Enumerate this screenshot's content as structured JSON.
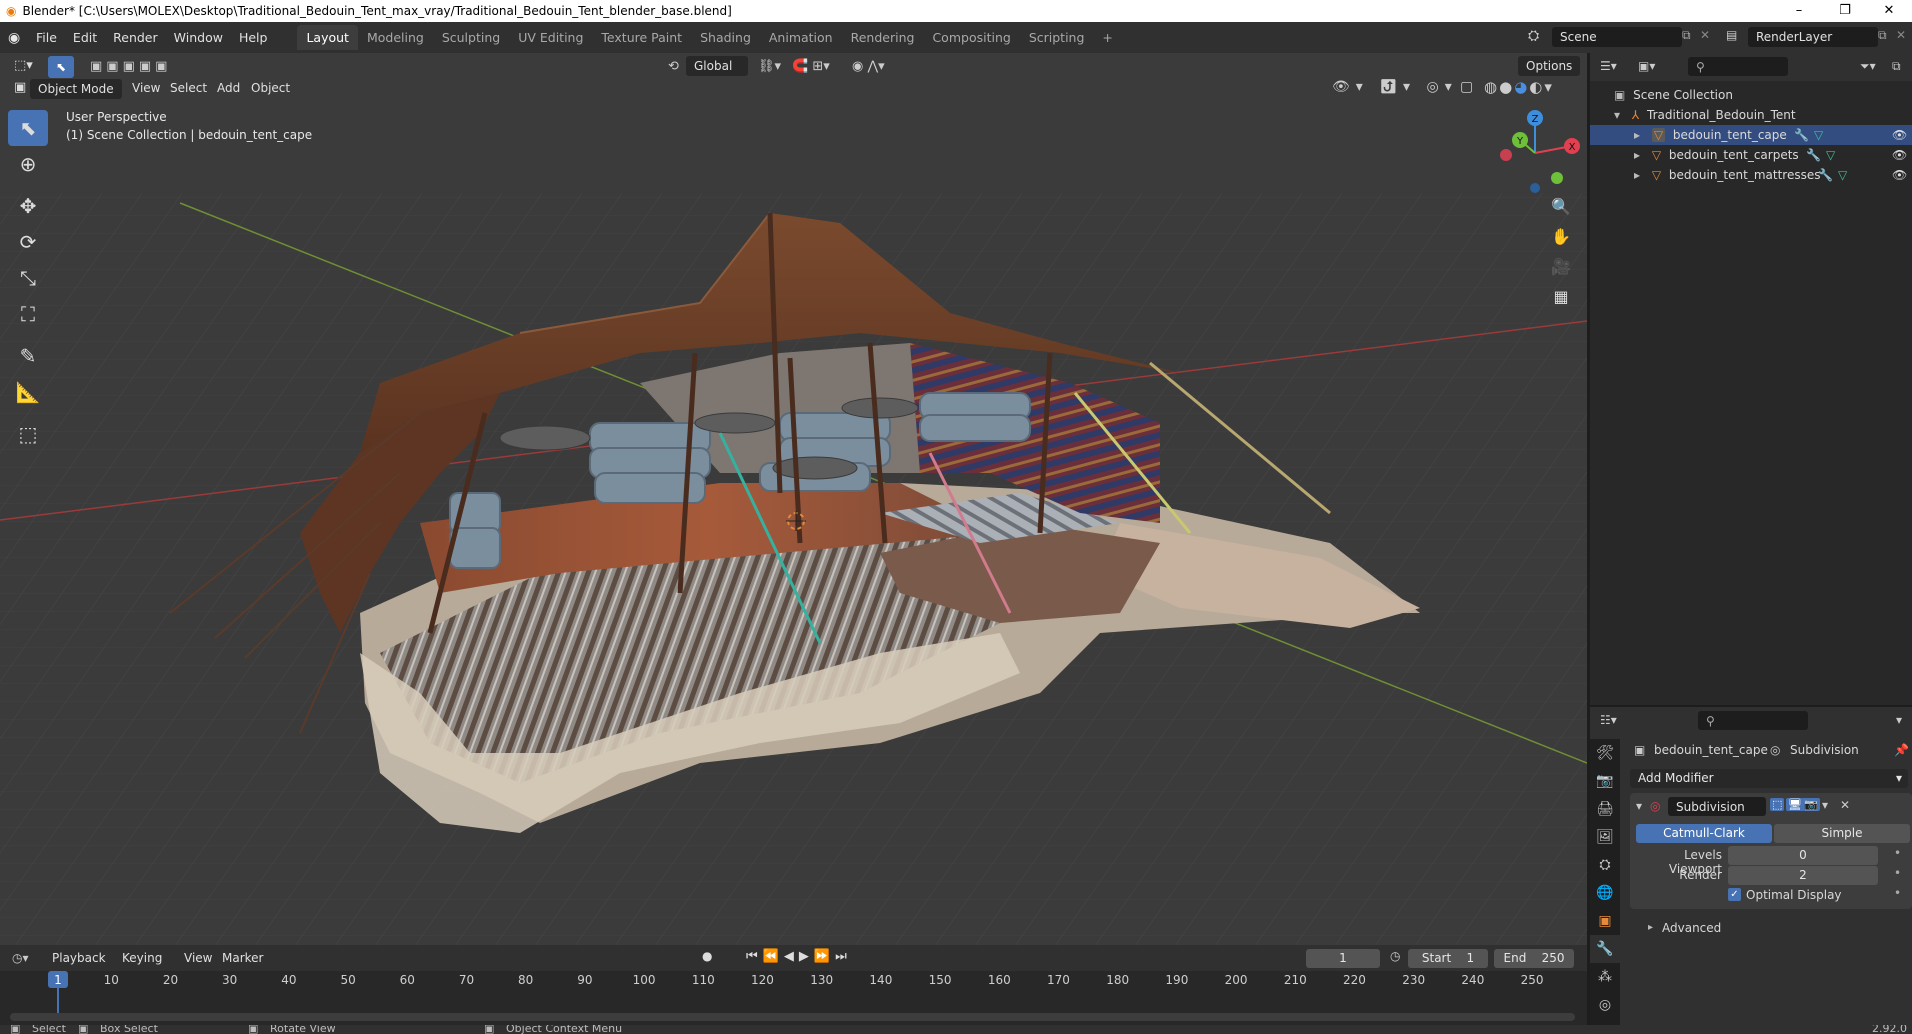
{
  "window": {
    "title": "Blender* [C:\\Users\\MOLEX\\Desktop\\Traditional_Bedouin_Tent_max_vray/Traditional_Bedouin_Tent_blender_base.blend]",
    "minimize": "–",
    "restore": "❐",
    "close": "✕"
  },
  "topbar": {
    "menus": [
      "File",
      "Edit",
      "Render",
      "Window",
      "Help"
    ],
    "workspaces": [
      "Layout",
      "Modeling",
      "Sculpting",
      "UV Editing",
      "Texture Paint",
      "Shading",
      "Animation",
      "Rendering",
      "Compositing",
      "Scripting"
    ],
    "add_workspace": "+",
    "scene": "Scene",
    "render_layer": "RenderLayer"
  },
  "viewport": {
    "header": {
      "mode": "Object Mode",
      "menus": [
        "View",
        "Select",
        "Add",
        "Object"
      ],
      "orientation": "Global",
      "options": "Options"
    },
    "overlay_text": {
      "perspective": "User Perspective",
      "collection": "(1) Scene Collection | bedouin_tent_cape"
    },
    "gizmo": {
      "z": "Z",
      "y": "Y",
      "x": "X"
    },
    "tools": [
      "select-box-tool",
      "cursor-tool",
      "move-tool",
      "rotate-tool",
      "scale-tool",
      "transform-tool",
      "annotate-tool",
      "measure-tool",
      "add-cube-tool"
    ]
  },
  "outliner": {
    "root": "Scene Collection",
    "collection": "Traditional_Bedouin_Tent",
    "objects": [
      "bedouin_tent_cape",
      "bedouin_tent_carpets",
      "bedouin_tent_mattresses"
    ]
  },
  "properties": {
    "object_name": "bedouin_tent_cape",
    "modifier_breadcrumb": "Subdivision",
    "add_modifier": "Add Modifier",
    "modifier": {
      "name": "Subdivision",
      "type_options": [
        "Catmull-Clark",
        "Simple"
      ],
      "selected_type": "Catmull-Clark",
      "levels_viewport_label": "Levels Viewport",
      "levels_viewport": "0",
      "render_label": "Render",
      "render": "2",
      "optimal_display_label": "Optimal Display",
      "optimal_display": true,
      "advanced": "Advanced"
    }
  },
  "timeline": {
    "menus": [
      "Playback",
      "Keying",
      "View",
      "Marker"
    ],
    "current_frame": "1",
    "start_label": "Start",
    "start": "1",
    "end_label": "End",
    "end": "250",
    "ruler": [
      "1",
      "10",
      "20",
      "30",
      "40",
      "50",
      "60",
      "70",
      "80",
      "90",
      "100",
      "110",
      "120",
      "130",
      "140",
      "150",
      "160",
      "170",
      "180",
      "190",
      "200",
      "210",
      "220",
      "230",
      "240",
      "250"
    ]
  },
  "statusbar": {
    "items": [
      "Select",
      "Box Select",
      "Rotate View",
      "Object Context Menu"
    ],
    "version": "2.92.0"
  },
  "colors": {
    "accent": "#4772b3",
    "x_axis": "#b03a3a",
    "y_axis": "#7aa83a",
    "gizmo_x": "#e0404f",
    "gizmo_y": "#6ec03a",
    "gizmo_z": "#3d8fde",
    "tent_roof": "#6a3d25",
    "object_orange": "#e58a3a"
  }
}
